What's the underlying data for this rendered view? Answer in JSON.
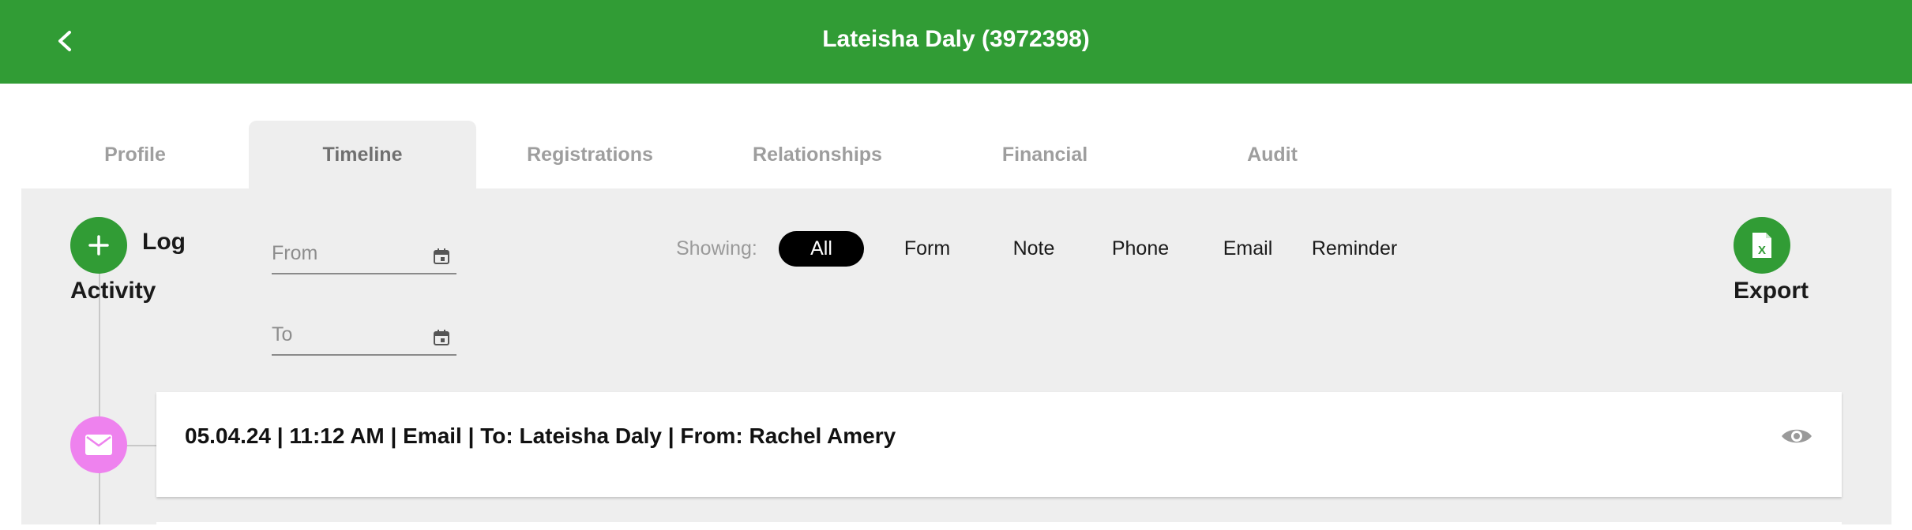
{
  "header": {
    "title": "Lateisha Daly (3972398)",
    "back_icon": "chevron-left-icon",
    "background": "#319c35"
  },
  "tabs": [
    {
      "label": "Profile",
      "active": false
    },
    {
      "label": "Timeline",
      "active": true
    },
    {
      "label": "Registrations",
      "active": false
    },
    {
      "label": "Relationships",
      "active": false
    },
    {
      "label": "Financial",
      "active": false
    },
    {
      "label": "Audit",
      "active": false
    }
  ],
  "toolbar": {
    "log_activity": {
      "line1": "Log",
      "line2": "Activity",
      "icon": "plus-icon"
    },
    "from_field": {
      "placeholder": "From",
      "value": "",
      "icon": "calendar-icon"
    },
    "to_field": {
      "placeholder": "To",
      "value": "",
      "icon": "calendar-icon"
    },
    "showing_label": "Showing:",
    "filters": [
      {
        "label": "All",
        "active": true
      },
      {
        "label": "Form",
        "active": false
      },
      {
        "label": "Note",
        "active": false
      },
      {
        "label": "Phone",
        "active": false
      },
      {
        "label": "Email",
        "active": false
      },
      {
        "label": "Reminder",
        "active": false
      }
    ],
    "export": {
      "label": "Export",
      "icon": "excel-icon"
    }
  },
  "timeline": [
    {
      "type_icon": "email-icon",
      "type_color": "#ee82ee",
      "text": "05.04.24 | 11:12 AM | Email | To: Lateisha Daly | From: Rachel Amery",
      "action_icon": "eye-icon"
    }
  ]
}
